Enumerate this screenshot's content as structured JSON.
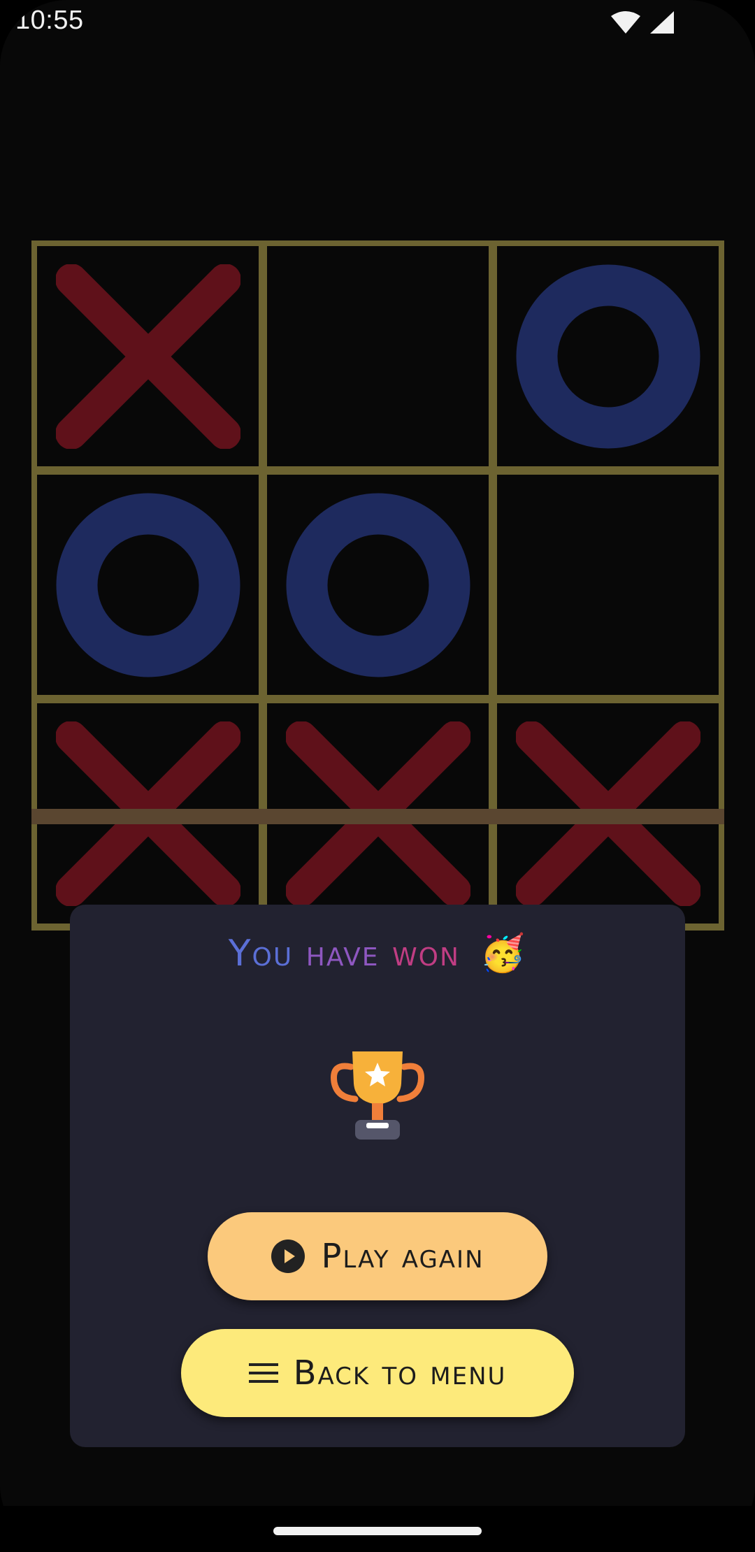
{
  "status_bar": {
    "time": "10:55",
    "icons": [
      "wifi-icon",
      "signal-icon"
    ]
  },
  "board": {
    "cells": [
      [
        "X",
        "",
        "O"
      ],
      [
        "O",
        "O",
        ""
      ],
      [
        "X",
        "X",
        "X"
      ]
    ],
    "colors": {
      "grid": "#6c6331",
      "x": "#5f111a",
      "o": "#1e2a5e",
      "cell_bg": "#080808"
    }
  },
  "dialog": {
    "title_words": [
      "You",
      "have",
      "won"
    ],
    "title_emoji": "🥳",
    "trophy_icon": "trophy-icon",
    "play_again_label": "Play again",
    "play_again_icon": "play-circle-icon",
    "back_to_menu_label": "Back to menu",
    "back_to_menu_icon": "menu-icon",
    "colors": {
      "background": "#222230",
      "play_again": "#fbc97c",
      "back_to_menu": "#fdea7b",
      "title_gradient": [
        "#5b6fd6",
        "#8e57c0",
        "#c03d83"
      ]
    }
  }
}
